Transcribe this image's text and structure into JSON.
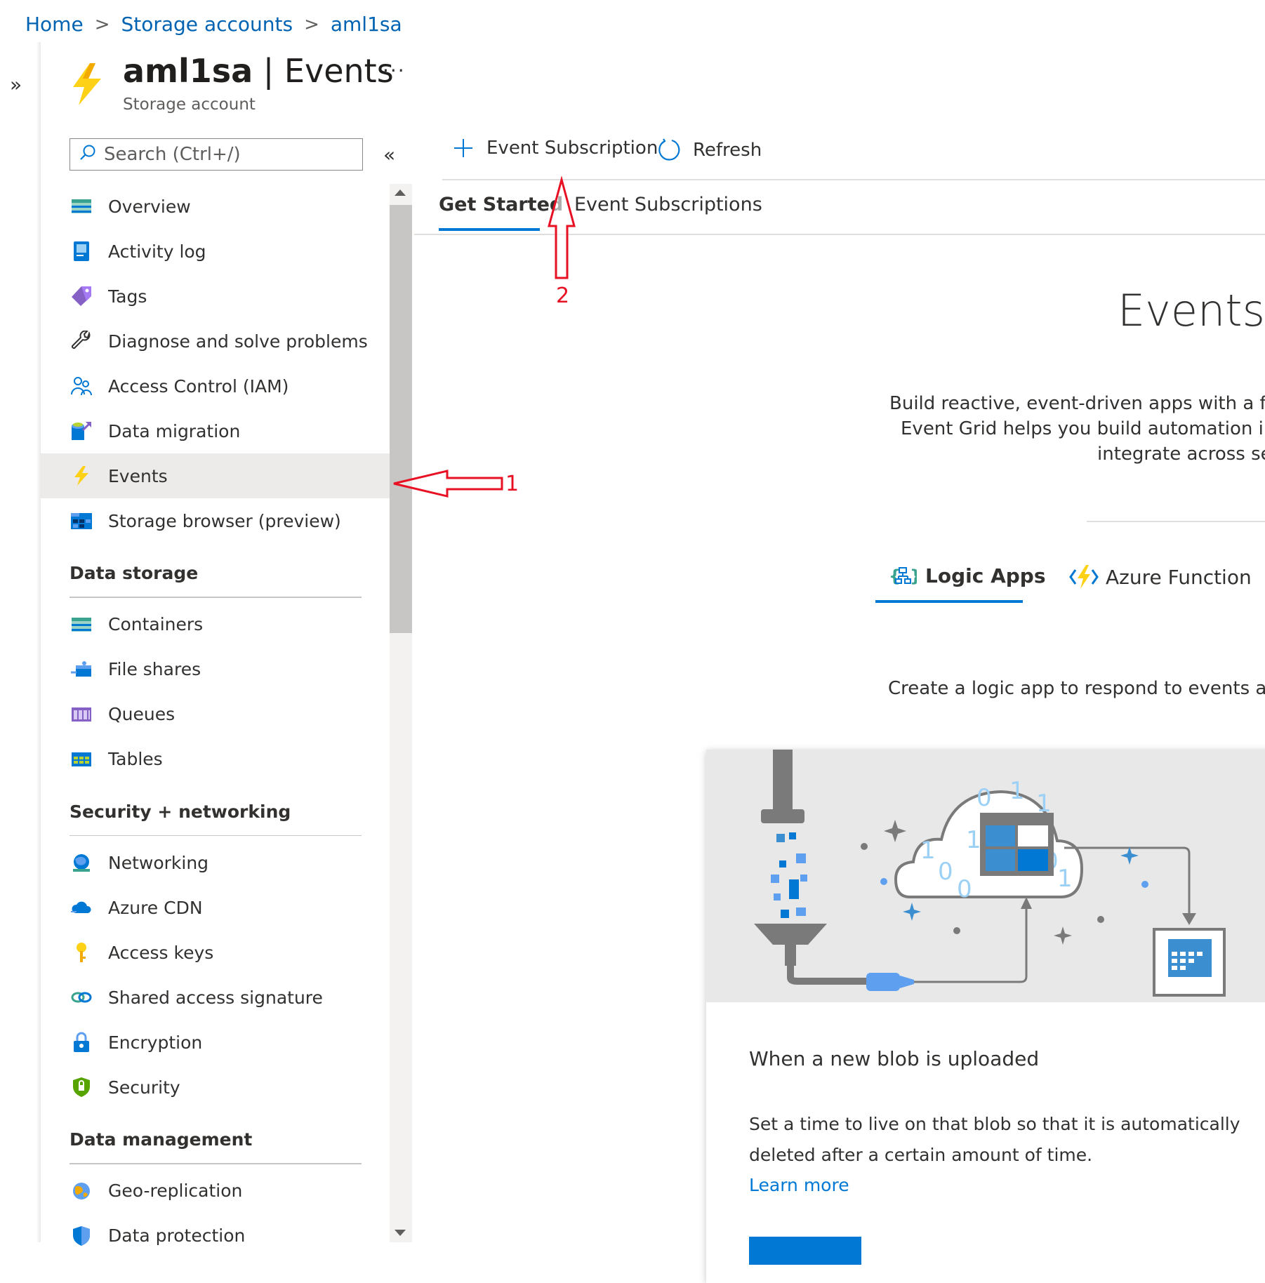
{
  "breadcrumb": {
    "home": "Home",
    "storage_accounts": "Storage accounts",
    "account": "aml1sa",
    "separator": ">"
  },
  "header": {
    "name": "aml1sa",
    "divider": " | ",
    "section": "Events",
    "subtitle": "Storage account",
    "more": "···",
    "expand": "»",
    "collapse": "«"
  },
  "search": {
    "placeholder": "Search (Ctrl+/)"
  },
  "nav": {
    "top": [
      {
        "label": "Overview",
        "icon": "overview-icon"
      },
      {
        "label": "Activity log",
        "icon": "activity-log-icon"
      },
      {
        "label": "Tags",
        "icon": "tag-icon"
      },
      {
        "label": "Diagnose and solve problems",
        "icon": "wrench-icon"
      },
      {
        "label": "Access Control (IAM)",
        "icon": "people-icon"
      },
      {
        "label": "Data migration",
        "icon": "data-migration-icon"
      },
      {
        "label": "Events",
        "icon": "lightning-icon",
        "active": true
      },
      {
        "label": "Storage browser (preview)",
        "icon": "storage-browser-icon"
      }
    ],
    "data_storage": {
      "title": "Data storage",
      "items": [
        {
          "label": "Containers",
          "icon": "containers-icon"
        },
        {
          "label": "File shares",
          "icon": "file-shares-icon"
        },
        {
          "label": "Queues",
          "icon": "queues-icon"
        },
        {
          "label": "Tables",
          "icon": "tables-icon"
        }
      ]
    },
    "security": {
      "title": "Security + networking",
      "items": [
        {
          "label": "Networking",
          "icon": "networking-icon"
        },
        {
          "label": "Azure CDN",
          "icon": "cloud-icon"
        },
        {
          "label": "Access keys",
          "icon": "key-icon"
        },
        {
          "label": "Shared access signature",
          "icon": "link-icon"
        },
        {
          "label": "Encryption",
          "icon": "lock-icon"
        },
        {
          "label": "Security",
          "icon": "shield-icon"
        }
      ]
    },
    "data_management": {
      "title": "Data management",
      "items": [
        {
          "label": "Geo-replication",
          "icon": "globe-icon"
        },
        {
          "label": "Data protection",
          "icon": "data-protection-icon"
        }
      ]
    }
  },
  "toolbar": {
    "event_subscription": "Event Subscription",
    "refresh": "Refresh"
  },
  "tabs": {
    "get_started": "Get Started",
    "event_subscriptions": "Event Subscriptions"
  },
  "content": {
    "hero_title": "Events, a",
    "desc_line1": "Build reactive, event-driven apps with a fully m",
    "desc_line2": "Event Grid helps you build automation into y",
    "desc_line3": "integrate across serv",
    "subtab_logic": "Logic Apps",
    "subtab_function": "Azure Function",
    "create_text": "Create a logic app to respond to events and o",
    "card_title": "When a new blob is uploaded",
    "card_text": "Set a time to live on that blob so that it is automatically deleted after a certain amount of time.",
    "card_link": "Learn more"
  },
  "annotations": {
    "arrow1_label": "1",
    "arrow2_label": "2"
  },
  "colors": {
    "accent": "#0078d4",
    "annotation": "#e81123",
    "active_bg": "#edebe9"
  }
}
